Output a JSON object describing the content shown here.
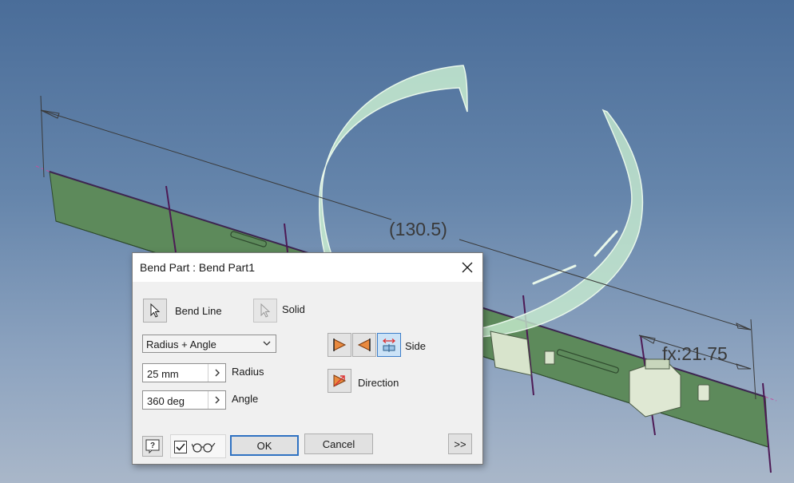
{
  "viewport": {
    "dimension_overall": "(130.5)",
    "dimension_fx": "fx:21.75"
  },
  "dialog": {
    "title": "Bend Part : Bend Part1",
    "bend_line_label": "Bend Line",
    "solid_label": "Solid",
    "method_select": "Radius + Angle",
    "radius_value": "25 mm",
    "radius_label": "Radius",
    "angle_value": "360 deg",
    "angle_label": "Angle",
    "side_label": "Side",
    "direction_label": "Direction",
    "ok_label": "OK",
    "cancel_label": "Cancel",
    "more_label": ">>",
    "preview_checked": true
  },
  "icons": {
    "select_arrow": "cursor-arrow-icon",
    "side_first": "side-left-icon",
    "side_second": "side-right-icon",
    "side_both": "side-symmetric-icon",
    "direction": "flip-direction-icon",
    "help": "help-icon",
    "preview": "preview-glasses-icon"
  },
  "colors": {
    "part_green": "#5e8a5a",
    "bend_preview": "#c8ecd0",
    "dim_line": "#3a3a3a",
    "bend_line": "#4d1a55",
    "accent_orange": "#e98a3f",
    "active_blue": "#cce3f7"
  }
}
